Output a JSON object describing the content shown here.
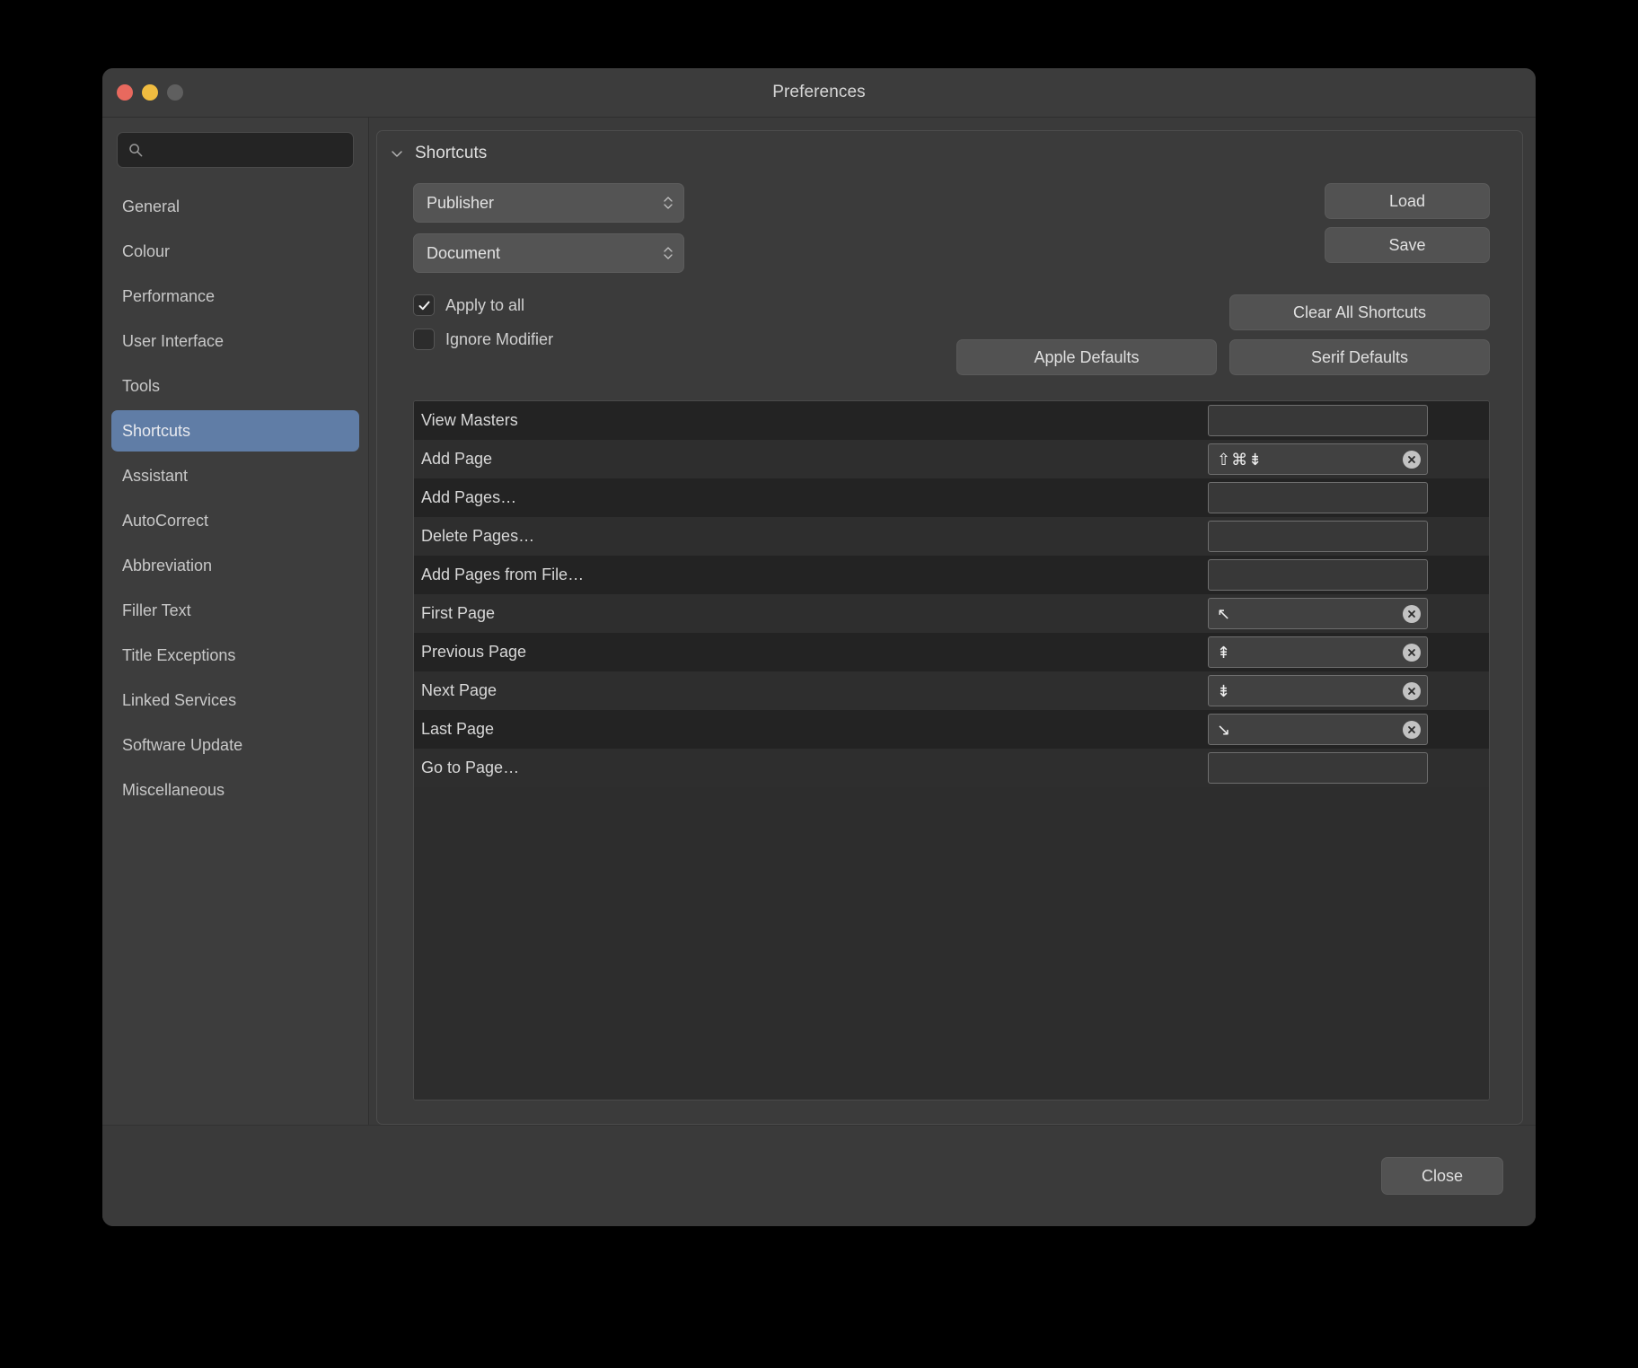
{
  "window": {
    "title": "Preferences",
    "traffic_lights": [
      "close",
      "minimize",
      "zoom"
    ]
  },
  "sidebar": {
    "search": {
      "value": "",
      "placeholder": "",
      "icon": "search-icon"
    },
    "items": [
      {
        "label": "General",
        "selected": false
      },
      {
        "label": "Colour",
        "selected": false
      },
      {
        "label": "Performance",
        "selected": false
      },
      {
        "label": "User Interface",
        "selected": false
      },
      {
        "label": "Tools",
        "selected": false
      },
      {
        "label": "Shortcuts",
        "selected": true
      },
      {
        "label": "Assistant",
        "selected": false
      },
      {
        "label": "AutoCorrect",
        "selected": false
      },
      {
        "label": "Abbreviation",
        "selected": false
      },
      {
        "label": "Filler Text",
        "selected": false
      },
      {
        "label": "Title Exceptions",
        "selected": false
      },
      {
        "label": "Linked Services",
        "selected": false
      },
      {
        "label": "Software Update",
        "selected": false
      },
      {
        "label": "Miscellaneous",
        "selected": false
      }
    ]
  },
  "content": {
    "section_title": "Shortcuts",
    "disclosure_icon": "chevron-down-icon",
    "popups": [
      {
        "name": "app-scope",
        "value": "Publisher",
        "icon": "stepper-arrows-icon"
      },
      {
        "name": "command-group",
        "value": "Document",
        "icon": "stepper-arrows-icon"
      }
    ],
    "buttons": {
      "load": "Load",
      "save": "Save",
      "clear_all": "Clear All Shortcuts",
      "apple_defaults": "Apple Defaults",
      "serif_defaults": "Serif Defaults",
      "close": "Close"
    },
    "checkboxes": [
      {
        "label": "Apply to all",
        "checked": true
      },
      {
        "label": "Ignore Modifier",
        "checked": false
      }
    ],
    "shortcuts": [
      {
        "command": "View Masters",
        "keys": "",
        "has_clear": false
      },
      {
        "command": "Add Page",
        "keys": "⇧⌘⇟",
        "has_clear": true
      },
      {
        "command": "Add Pages…",
        "keys": "",
        "has_clear": false
      },
      {
        "command": "Delete Pages…",
        "keys": "",
        "has_clear": false
      },
      {
        "command": "Add Pages from File…",
        "keys": "",
        "has_clear": false
      },
      {
        "command": "First Page",
        "keys": "↖",
        "has_clear": true
      },
      {
        "command": "Previous Page",
        "keys": "⇞",
        "has_clear": true
      },
      {
        "command": "Next Page",
        "keys": "⇟",
        "has_clear": true
      },
      {
        "command": "Last Page",
        "keys": "↘",
        "has_clear": true
      },
      {
        "command": "Go to Page…",
        "keys": "",
        "has_clear": false
      }
    ]
  },
  "colors": {
    "accent_selection": "#607da6",
    "window_bg": "#3a3a3a",
    "sidebar_bg": "#3d3d3d",
    "table_bg": "#2b2b2b",
    "traffic_close": "#e8695e",
    "traffic_min": "#f0bc40",
    "traffic_zoom": "#5f5f5f"
  }
}
